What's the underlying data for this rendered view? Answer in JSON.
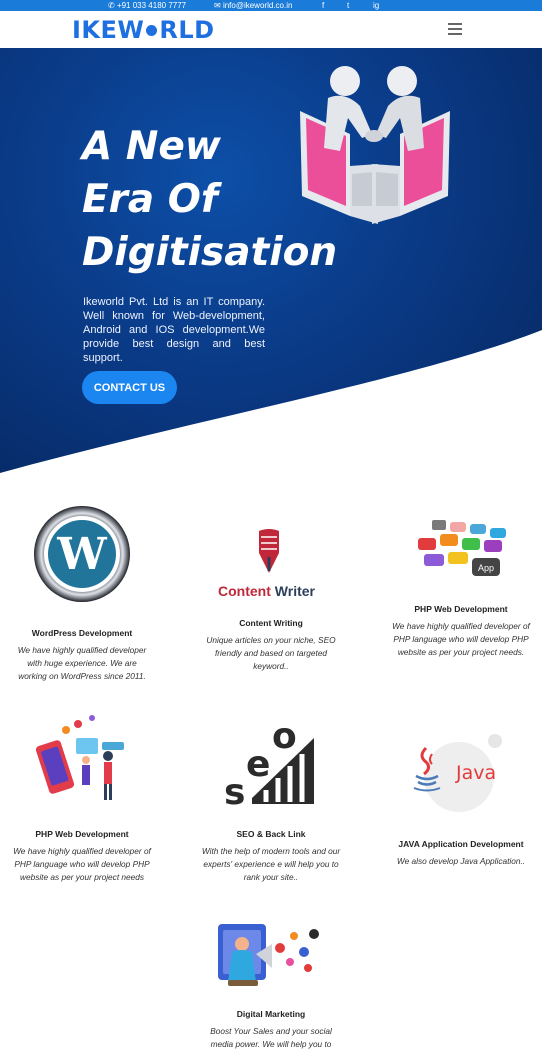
{
  "topbar": {
    "phone": "+91 033 4180 7777",
    "email": "info@ikeworld.co.in",
    "social": [
      "f",
      "t",
      "ig"
    ]
  },
  "header": {
    "logo_left": "IKEW",
    "logo_right": "RLD"
  },
  "hero": {
    "title_lines": [
      "A New",
      "Era Of",
      "Digitisation"
    ],
    "description": "Ikeworld Pvt. Ltd is an IT company. Well known for Web-development, Android and IOS development.We provide best design and best support.",
    "cta": "CONTACT US"
  },
  "services": [
    {
      "title": "WordPress Development",
      "description": "We have highly qualified developer with huge experience. We are working on WordPress since 2011."
    },
    {
      "title": "Content Writing",
      "description": "Unique articles on your niche, SEO friendly and based on targeted keyword..",
      "logo_text_left": "Content",
      "logo_text_right": "Writer"
    },
    {
      "title": "PHP Web Development",
      "description": "We have highly qualified developer of PHP language who will develop PHP website as per your project needs.",
      "badge": "App"
    },
    {
      "title": "PHP Web Development",
      "description": "We have highly qualified developer of PHP language who will develop PHP website as per your project needs"
    },
    {
      "title": "SEO & Back Link",
      "description": "With the help of modern tools and our experts' experience e will help you to rank your site..",
      "logo_letters": [
        "s",
        "e",
        "o"
      ]
    },
    {
      "title": "JAVA Application Development",
      "description": "We also develop Java Application..",
      "logo_text": "Java"
    },
    {
      "title": "Digital Marketing",
      "description": "Boost Your Sales and your social media power. We will help you to"
    }
  ]
}
